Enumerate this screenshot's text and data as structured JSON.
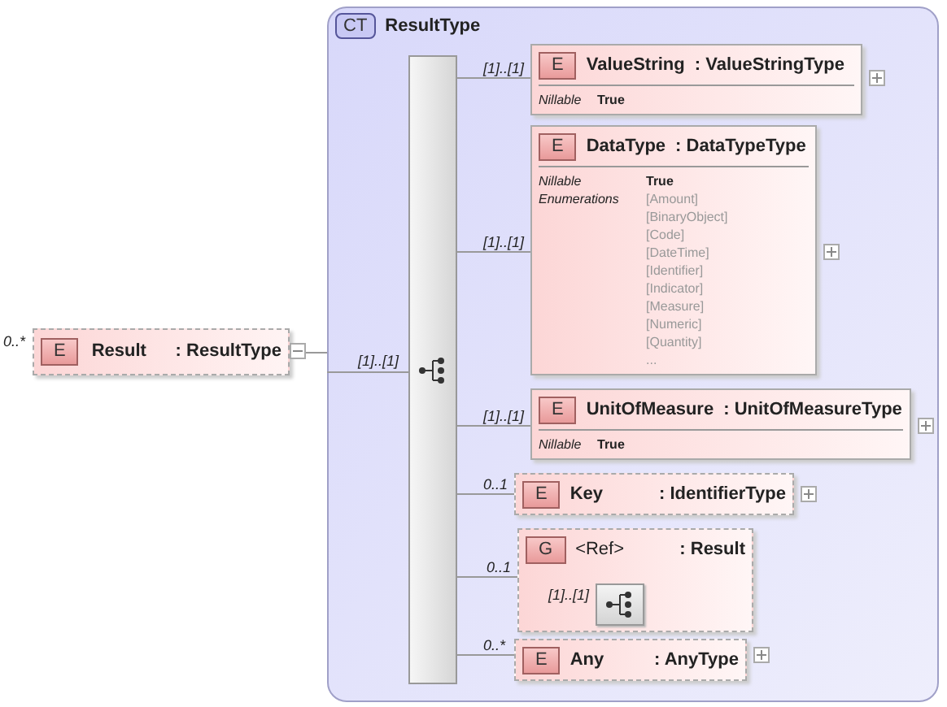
{
  "root": {
    "cardinality": "0..*",
    "badge": "E",
    "name": "Result",
    "type": ": ResultType",
    "optional": true,
    "expanded": true
  },
  "complex_type": {
    "badge": "CT",
    "name": "ResultType",
    "sequence_cardinality": "[1]..[1]"
  },
  "children": [
    {
      "kind": "element",
      "cardinality": "[1]..[1]",
      "badge": "E",
      "name": "ValueString",
      "type": ": ValueStringType",
      "optional": false,
      "expanded": false,
      "properties": [
        {
          "kind": "value",
          "label": "Nillable",
          "values": [
            "True"
          ]
        }
      ]
    },
    {
      "kind": "element",
      "cardinality": "[1]..[1]",
      "badge": "E",
      "name": "DataType",
      "type": ": DataTypeType",
      "optional": false,
      "expanded": false,
      "properties": [
        {
          "kind": "value",
          "label": "Nillable",
          "values": [
            "True"
          ]
        },
        {
          "kind": "enumeration",
          "label": "Enumerations",
          "values": [
            "[Amount]",
            "[BinaryObject]",
            "[Code]",
            "[DateTime]",
            "[Identifier]",
            "[Indicator]",
            "[Measure]",
            "[Numeric]",
            "[Quantity]",
            "..."
          ]
        }
      ]
    },
    {
      "kind": "element",
      "cardinality": "[1]..[1]",
      "badge": "E",
      "name": "UnitOfMeasure",
      "type": ": UnitOfMeasureType",
      "optional": false,
      "expanded": false,
      "properties": [
        {
          "kind": "value",
          "label": "Nillable",
          "values": [
            "True"
          ]
        }
      ]
    },
    {
      "kind": "element",
      "cardinality": "0..1",
      "badge": "E",
      "name": "Key",
      "type": ": IdentifierType",
      "optional": true,
      "expanded": false
    },
    {
      "kind": "group",
      "cardinality": "0..1",
      "badge": "G",
      "name": "<Ref>",
      "type": ": Result",
      "optional": true,
      "sequence_cardinality": "[1]..[1]"
    },
    {
      "kind": "element",
      "cardinality": "0..*",
      "badge": "E",
      "name": "Any",
      "type": ": AnyType",
      "optional": true,
      "expanded": false
    }
  ]
}
